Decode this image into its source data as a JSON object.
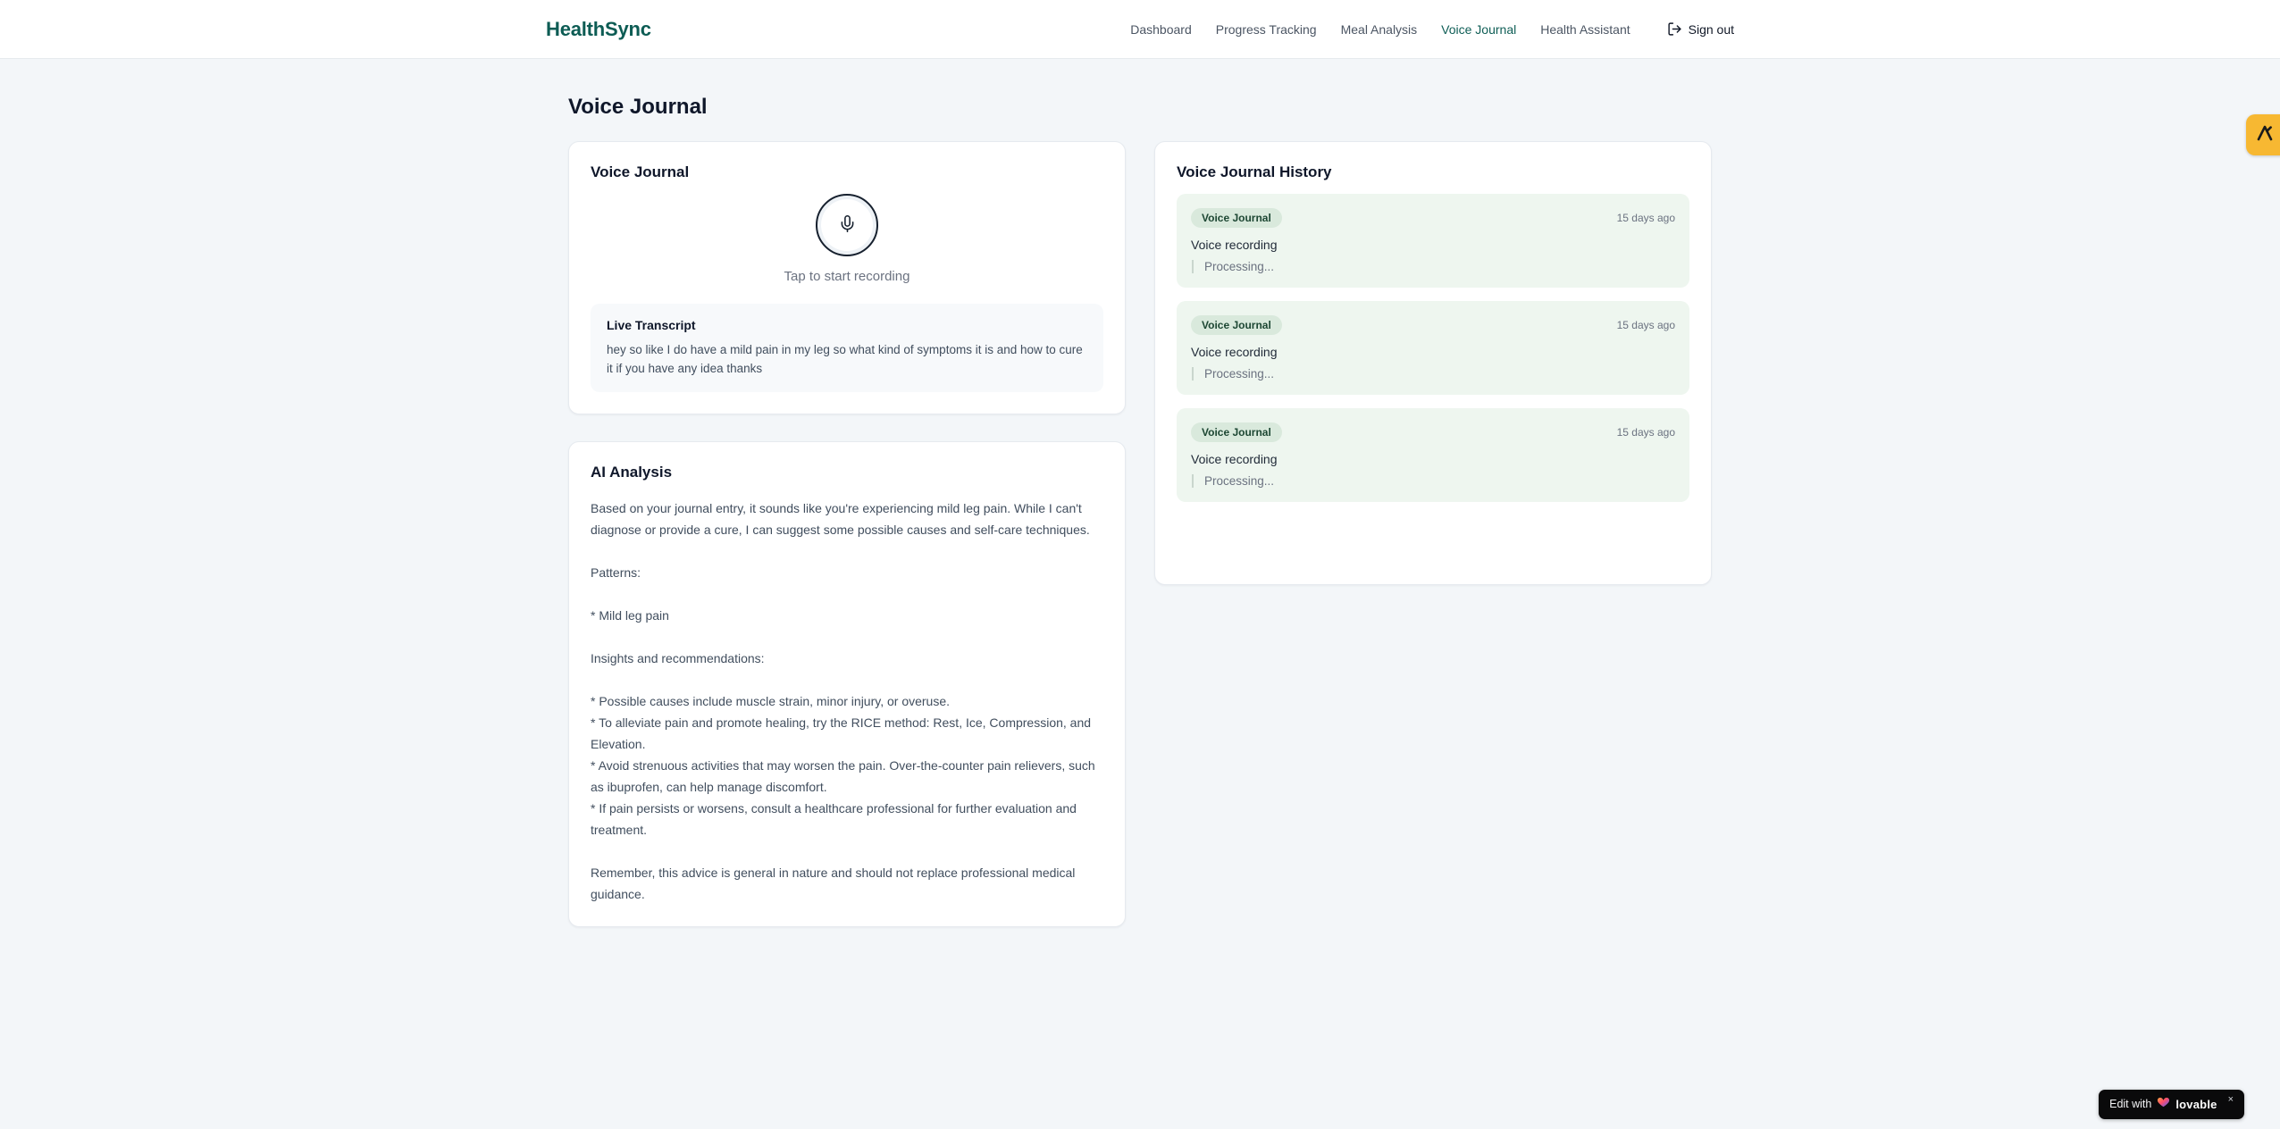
{
  "brand": {
    "name": "HealthSync"
  },
  "nav": {
    "items": [
      {
        "label": "Dashboard",
        "active": false
      },
      {
        "label": "Progress Tracking",
        "active": false
      },
      {
        "label": "Meal Analysis",
        "active": false
      },
      {
        "label": "Voice Journal",
        "active": true
      },
      {
        "label": "Health Assistant",
        "active": false
      }
    ],
    "sign_out_label": "Sign out"
  },
  "page": {
    "title": "Voice Journal"
  },
  "recorder": {
    "card_title": "Voice Journal",
    "tap_hint": "Tap to start recording",
    "transcript": {
      "title": "Live Transcript",
      "text": "hey so like I do have a mild pain in my leg so what kind of symptoms it is and how to cure it if you have any idea thanks"
    }
  },
  "analysis": {
    "card_title": "AI Analysis",
    "blocks": [
      "Based on your journal entry, it sounds like you're experiencing mild leg pain. While I can't diagnose or provide a cure, I can suggest some possible causes and self-care techniques.",
      "Patterns:",
      "* Mild leg pain",
      "Insights and recommendations:",
      "* Possible causes include muscle strain, minor injury, or overuse.\n* To alleviate pain and promote healing, try the RICE method: Rest, Ice, Compression, and Elevation.\n* Avoid strenuous activities that may worsen the pain. Over-the-counter pain relievers, such as ibuprofen, can help manage discomfort.\n* If pain persists or worsens, consult a healthcare professional for further evaluation and treatment.",
      "Remember, this advice is general in nature and should not replace professional medical guidance."
    ]
  },
  "history": {
    "card_title": "Voice Journal History",
    "entries": [
      {
        "badge": "Voice Journal",
        "time": "15 days ago",
        "label": "Voice recording",
        "status": "Processing..."
      },
      {
        "badge": "Voice Journal",
        "time": "15 days ago",
        "label": "Voice recording",
        "status": "Processing..."
      },
      {
        "badge": "Voice Journal",
        "time": "15 days ago",
        "label": "Voice recording",
        "status": "Processing..."
      }
    ]
  },
  "badges": {
    "lovable": {
      "prefix": "Edit with",
      "brand": "lovable",
      "close": "×"
    }
  },
  "colors": {
    "accent_teal": "#0d5c54",
    "nav_active": "#0f5e56",
    "entry_bg": "#eef6ef",
    "entry_badge_bg": "#d9e9dc",
    "entry_badge_text": "#1d4733",
    "side_badge_amber": "#f7b832",
    "page_bg": "#f3f6f9"
  }
}
